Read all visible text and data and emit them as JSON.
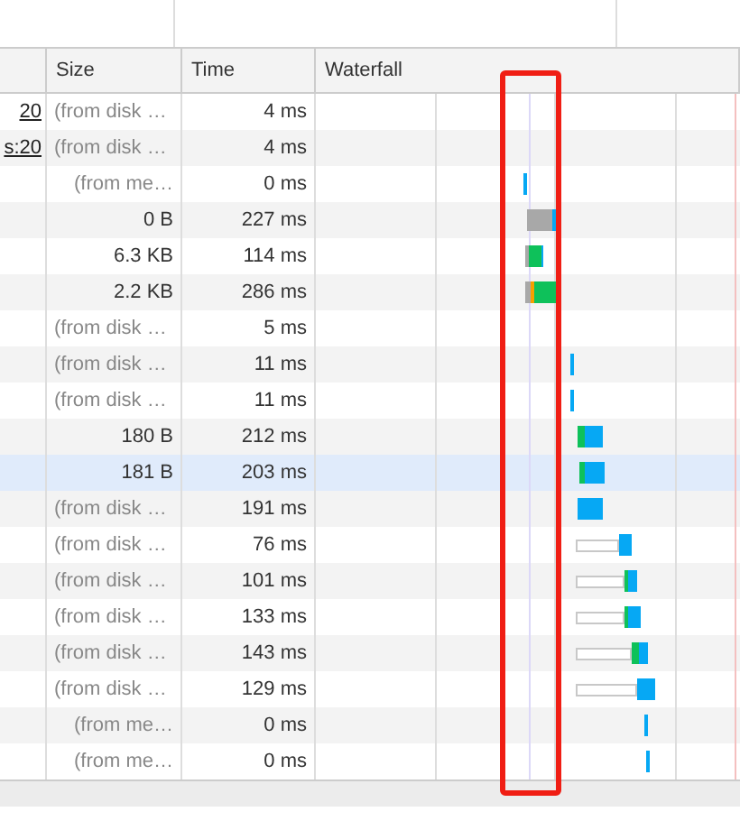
{
  "columns": [
    "Size",
    "Time",
    "Waterfall"
  ],
  "rows": [
    {
      "initiator": "20",
      "size": "(from disk …",
      "time": "4 ms",
      "cached": true,
      "selected": false
    },
    {
      "initiator": "s:20",
      "size": "(from disk …",
      "time": "4 ms",
      "cached": true,
      "selected": false
    },
    {
      "size": "(from me…",
      "time": "0 ms",
      "cached": true,
      "selected": false
    },
    {
      "size": "0 B",
      "time": "227 ms",
      "cached": false,
      "selected": false
    },
    {
      "size": "6.3 KB",
      "time": "114 ms",
      "cached": false,
      "selected": false
    },
    {
      "size": "2.2 KB",
      "time": "286 ms",
      "cached": false,
      "selected": false
    },
    {
      "size": "(from disk …",
      "time": "5 ms",
      "cached": true,
      "selected": false
    },
    {
      "size": "(from disk …",
      "time": "11 ms",
      "cached": true,
      "selected": false
    },
    {
      "size": "(from disk …",
      "time": "11 ms",
      "cached": true,
      "selected": false
    },
    {
      "size": "180 B",
      "time": "212 ms",
      "cached": false,
      "selected": false
    },
    {
      "size": "181 B",
      "time": "203 ms",
      "cached": false,
      "selected": true
    },
    {
      "size": "(from disk …",
      "time": "191 ms",
      "cached": true,
      "selected": false
    },
    {
      "size": "(from disk …",
      "time": "76 ms",
      "cached": true,
      "selected": false
    },
    {
      "size": "(from disk …",
      "time": "101 ms",
      "cached": true,
      "selected": false
    },
    {
      "size": "(from disk …",
      "time": "133 ms",
      "cached": true,
      "selected": false
    },
    {
      "size": "(from disk …",
      "time": "143 ms",
      "cached": true,
      "selected": false
    },
    {
      "size": "(from disk …",
      "time": "129 ms",
      "cached": true,
      "selected": false
    },
    {
      "size": "(from me…",
      "time": "0 ms",
      "cached": true,
      "selected": false
    },
    {
      "size": "(from me…",
      "time": "0 ms",
      "cached": true,
      "selected": false
    }
  ]
}
